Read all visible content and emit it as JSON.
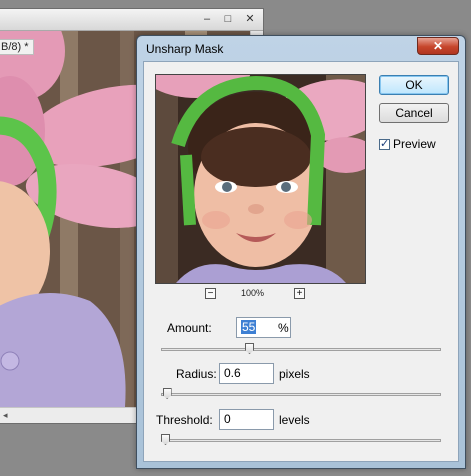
{
  "document_window": {
    "title_fragment": "B/8) *",
    "minimize_glyph": "‒",
    "maximize_glyph": "□",
    "close_glyph": "✕",
    "scroll_left_glyph": "◂"
  },
  "dialog": {
    "title": "Unsharp Mask",
    "close_glyph": "✕",
    "ok_label": "OK",
    "cancel_label": "Cancel",
    "preview_label": "Preview",
    "preview_checked": true,
    "zoom_out_glyph": "−",
    "zoom_in_glyph": "+",
    "zoom_level": "100%",
    "amount": {
      "label": "Amount:",
      "value": "55",
      "unit": "%",
      "slider_level": 0.31
    },
    "radius": {
      "label": "Radius:",
      "value": "0.6",
      "unit": "pixels",
      "slider_level": 0.006
    },
    "threshold": {
      "label": "Threshold:",
      "value": "0",
      "unit": "levels",
      "slider_level": 0.0
    }
  },
  "colors": {
    "dialog_frame": "#a9c2d8",
    "close_button": "#c6452b",
    "default_button": "#bee6fd",
    "text_selection": "#3d7fd3"
  }
}
